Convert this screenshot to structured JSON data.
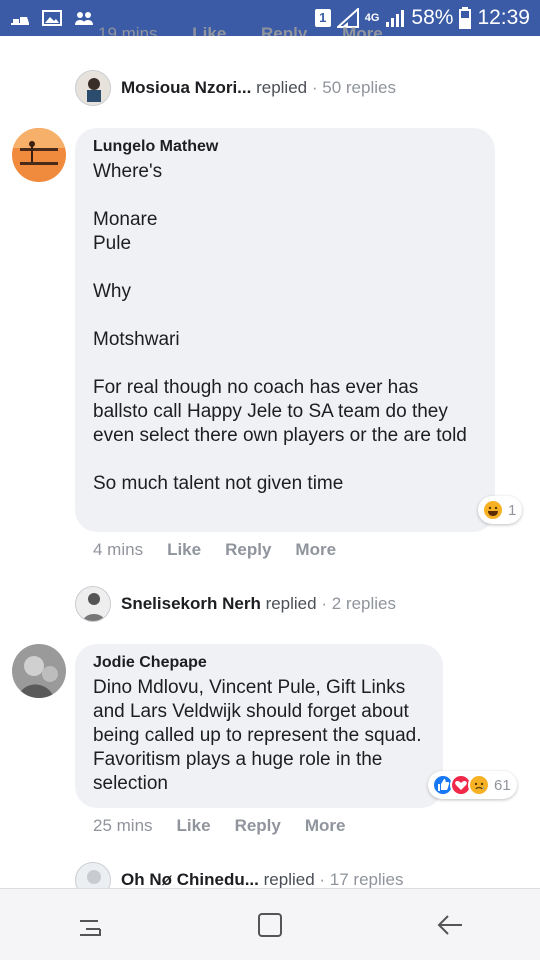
{
  "status_bar": {
    "sim_label": "1",
    "network": "4G",
    "battery": "58%",
    "time": "12:39"
  },
  "cut_line": {
    "time": "19 mins",
    "like": "Like",
    "reply": "Reply",
    "more": "More"
  },
  "reply_rows": [
    {
      "name": "Mosioua Nzori...",
      "verb": "replied",
      "count": "· 50 replies"
    },
    {
      "name": "Snelisekorh Nerh",
      "verb": "replied",
      "count": "· 2 replies"
    },
    {
      "name": "Oh Nø Chinedu...",
      "verb": "replied",
      "count": "· 17 replies"
    }
  ],
  "comments": [
    {
      "author": "Lungelo Mathew",
      "body": "Where's\n\nMonare\nPule\n\nWhy\n\nMotshwari\n\nFor real though no coach has ever has ballsto call Happy Jele to SA team do they even select there own players or the are told\n\nSo much talent not given time",
      "time": "4 mins",
      "like": "Like",
      "reply": "Reply",
      "more": "More",
      "reaction_count": "1",
      "reactions": [
        "haha-icon"
      ]
    },
    {
      "author": "Jodie Chepape",
      "body": "Dino Mdlovu, Vincent Pule, Gift Links and Lars Veldwijk should forget about being called up to represent the squad. Favoritism plays a huge role in the selection",
      "time": "25 mins",
      "like": "Like",
      "reply": "Reply",
      "more": "More",
      "reaction_count": "61",
      "reactions": [
        "like-icon",
        "love-icon",
        "sad-icon"
      ]
    }
  ],
  "colors": {
    "status_bar": "#3b5ba7",
    "bubble": "#f0f1f4",
    "muted": "#90949c",
    "like_blue": "#1877f2",
    "love_red": "#f0284a",
    "haha_yellow": "#f7b125"
  }
}
